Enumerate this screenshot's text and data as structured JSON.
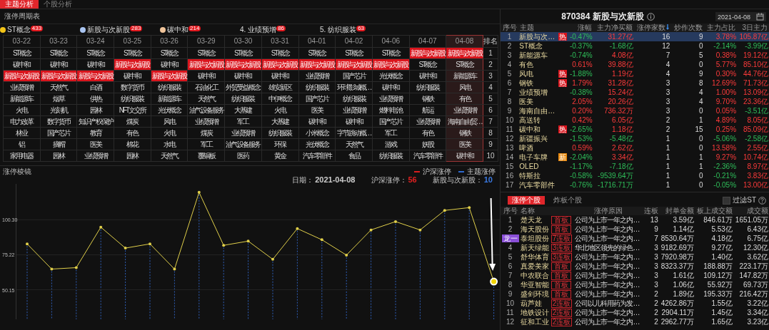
{
  "top_tabs": [
    {
      "label": "主题分析",
      "selected": true
    },
    {
      "label": "个股分析",
      "selected": false
    }
  ],
  "cycle_table": {
    "title": "涨停周期表",
    "leaders": [
      {
        "label": "ST概念",
        "count": "433",
        "kind": "medal",
        "color": "#f2c418"
      },
      {
        "label": "新股与次新股",
        "count": "283",
        "kind": "medal",
        "color": "#a9c4f0"
      },
      {
        "label": "碳中和",
        "count": "214",
        "kind": "medal",
        "color": "#f0c49a"
      },
      {
        "label": "4. 业绩预增",
        "count": "86",
        "kind": "plain"
      },
      {
        "label": "5. 纺织服装",
        "count": "63",
        "kind": "plain"
      }
    ],
    "rank_header": "排名",
    "ranks": [
      "1",
      "2",
      "3",
      "4",
      "5",
      "6",
      "7",
      "8",
      "9",
      "10"
    ],
    "columns": [
      {
        "date": "03-22",
        "selected": false,
        "cells": [
          {
            "text": "ST概念",
            "hot": false
          },
          {
            "text": "碳中和",
            "hot": false
          },
          {
            "text": "新股与次新股",
            "hot": true
          },
          {
            "text": "业绩预增",
            "hot": false
          },
          {
            "text": "新能源车",
            "hot": false
          },
          {
            "text": "火电",
            "hot": false
          },
          {
            "text": "电力改革",
            "hot": false
          },
          {
            "text": "林业",
            "hot": false
          },
          {
            "text": "铝",
            "hot": false
          },
          {
            "text": "家用电器",
            "hot": false
          }
        ]
      },
      {
        "date": "03-23",
        "selected": false,
        "cells": [
          {
            "text": "ST概念",
            "hot": false
          },
          {
            "text": "碳中和",
            "hot": false
          },
          {
            "text": "新股与次新股",
            "hot": true
          },
          {
            "text": "天然气",
            "hot": false
          },
          {
            "text": "烟草",
            "hot": false
          },
          {
            "text": "光刻机",
            "hot": false
          },
          {
            "text": "数字货币",
            "hot": false
          },
          {
            "text": "国产芯片",
            "hot": false
          },
          {
            "text": "摘帽",
            "hot": false
          },
          {
            "text": "园林",
            "hot": false
          }
        ]
      },
      {
        "date": "03-24",
        "selected": false,
        "cells": [
          {
            "text": "ST概念",
            "hot": false
          },
          {
            "text": "碳中和",
            "hot": false
          },
          {
            "text": "新股与次新股",
            "hot": true
          },
          {
            "text": "白酒",
            "hot": false
          },
          {
            "text": "供热",
            "hot": false
          },
          {
            "text": "园林",
            "hot": false
          },
          {
            "text": "知识产权保护",
            "hot": false
          },
          {
            "text": "教育",
            "hot": false
          },
          {
            "text": "医美",
            "hot": false
          },
          {
            "text": "业绩预增",
            "hot": false
          }
        ]
      },
      {
        "date": "03-25",
        "selected": false,
        "cells": [
          {
            "text": "ST概念",
            "hot": false
          },
          {
            "text": "新股与次新股",
            "hot": true
          },
          {
            "text": "碳中和",
            "hot": false
          },
          {
            "text": "数字货币",
            "hot": false
          },
          {
            "text": "纺织服装",
            "hot": false
          },
          {
            "text": "NFT文交所",
            "hot": false
          },
          {
            "text": "煤炭",
            "hot": false
          },
          {
            "text": "有色",
            "hot": false
          },
          {
            "text": "棉花",
            "hot": false
          },
          {
            "text": "园林",
            "hot": false
          }
        ]
      },
      {
        "date": "03-26",
        "selected": false,
        "cells": [
          {
            "text": "ST概念",
            "hot": false
          },
          {
            "text": "碳中和",
            "hot": false
          },
          {
            "text": "新股与次新股",
            "hot": true
          },
          {
            "text": "纺织服装",
            "hot": false
          },
          {
            "text": "新能源车",
            "hot": false
          },
          {
            "text": "光伏概念",
            "hot": false
          },
          {
            "text": "风电",
            "hot": false
          },
          {
            "text": "火电",
            "hot": false
          },
          {
            "text": "水电",
            "hot": false
          },
          {
            "text": "天然气",
            "hot": false
          }
        ]
      },
      {
        "date": "03-29",
        "selected": false,
        "cells": [
          {
            "text": "ST概念",
            "hot": false
          },
          {
            "text": "新股与次新股",
            "hot": true
          },
          {
            "text": "碳中和",
            "hot": false
          },
          {
            "text": "石油化工",
            "hot": false
          },
          {
            "text": "天然气",
            "hot": false
          },
          {
            "text": "油气设备服务",
            "hot": false
          },
          {
            "text": "业绩预增",
            "hot": false
          },
          {
            "text": "煤炭",
            "hot": false
          },
          {
            "text": "军工",
            "hot": false
          },
          {
            "text": "覆铜板",
            "hot": false
          }
        ]
      },
      {
        "date": "03-30",
        "selected": false,
        "cells": [
          {
            "text": "ST概念",
            "hot": false
          },
          {
            "text": "新股与次新股",
            "hot": true
          },
          {
            "text": "碳中和",
            "hot": false
          },
          {
            "text": "外贸受益概念",
            "hot": false
          },
          {
            "text": "纺织服装",
            "hot": false
          },
          {
            "text": "大基建",
            "hot": false
          },
          {
            "text": "军工",
            "hot": false
          },
          {
            "text": "业绩预增",
            "hot": false
          },
          {
            "text": "油气设备服务",
            "hot": false
          },
          {
            "text": "医药",
            "hot": false
          }
        ]
      },
      {
        "date": "03-31",
        "selected": false,
        "cells": [
          {
            "text": "ST概念",
            "hot": false
          },
          {
            "text": "新股与次新股",
            "hot": true
          },
          {
            "text": "碳中和",
            "hot": false
          },
          {
            "text": "雄安新区",
            "hot": false
          },
          {
            "text": "中伊概念",
            "hot": false
          },
          {
            "text": "火电",
            "hot": false
          },
          {
            "text": "大基建",
            "hot": false
          },
          {
            "text": "纺织服装",
            "hot": false
          },
          {
            "text": "环保",
            "hot": false
          },
          {
            "text": "黄金",
            "hot": false
          }
        ]
      },
      {
        "date": "04-01",
        "selected": false,
        "cells": [
          {
            "text": "ST概念",
            "hot": false
          },
          {
            "text": "新股与次新股",
            "hot": true
          },
          {
            "text": "业绩预增",
            "hot": false
          },
          {
            "text": "纺织服装",
            "hot": false
          },
          {
            "text": "国产芯片",
            "hot": false
          },
          {
            "text": "医美",
            "hot": false
          },
          {
            "text": "碳中和",
            "hot": false
          },
          {
            "text": "小米概念",
            "hot": false
          },
          {
            "text": "光伏概念",
            "hot": false
          },
          {
            "text": "汽车零部件",
            "hot": false
          }
        ]
      },
      {
        "date": "04-02",
        "selected": false,
        "cells": [
          {
            "text": "ST概念",
            "hot": false
          },
          {
            "text": "新股与次新股",
            "hot": true
          },
          {
            "text": "国产芯片",
            "hot": false
          },
          {
            "text": "环球影城概…",
            "hot": false
          },
          {
            "text": "纺织服装",
            "hot": false
          },
          {
            "text": "业绩预增",
            "hot": false
          },
          {
            "text": "碳中和",
            "hot": false
          },
          {
            "text": "字节跳动概…",
            "hot": false
          },
          {
            "text": "天然气",
            "hot": false
          },
          {
            "text": "食品",
            "hot": false
          }
        ]
      },
      {
        "date": "04-06",
        "selected": false,
        "cells": [
          {
            "text": "ST概念",
            "hot": false
          },
          {
            "text": "新股与次新股",
            "hot": true
          },
          {
            "text": "光伏概念",
            "hot": false
          },
          {
            "text": "碳中和",
            "hot": false
          },
          {
            "text": "业绩预增",
            "hot": false
          },
          {
            "text": "燃料电池",
            "hot": false
          },
          {
            "text": "国产芯片",
            "hot": false
          },
          {
            "text": "军工",
            "hot": false
          },
          {
            "text": "游戏",
            "hot": false
          },
          {
            "text": "纺织服装",
            "hot": false
          }
        ]
      },
      {
        "date": "04-07",
        "selected": false,
        "cells": [
          {
            "text": "新股与次新股",
            "hot": true
          },
          {
            "text": "ST概念",
            "hot": false
          },
          {
            "text": "碳中和",
            "hot": false
          },
          {
            "text": "纺织服装",
            "hot": false
          },
          {
            "text": "钢铁",
            "hot": false
          },
          {
            "text": "航运",
            "hot": false
          },
          {
            "text": "业绩预增",
            "hot": false
          },
          {
            "text": "有色",
            "hot": false
          },
          {
            "text": "妖股",
            "hot": false
          },
          {
            "text": "汽车零部件",
            "hot": false
          }
        ]
      },
      {
        "date": "04-08",
        "selected": true,
        "cells": [
          {
            "text": "新股与次新股",
            "hot": true
          },
          {
            "text": "ST概念",
            "hot": false
          },
          {
            "text": "新能源车",
            "hot": false
          },
          {
            "text": "风电",
            "hot": false
          },
          {
            "text": "有色",
            "hot": false
          },
          {
            "text": "业绩预增",
            "hot": false
          },
          {
            "text": "海南自由贸…",
            "hot": false
          },
          {
            "text": "钢铁",
            "hot": false
          },
          {
            "text": "医美",
            "hot": false
          },
          {
            "text": "碳中和",
            "hot": false
          }
        ]
      }
    ]
  },
  "prism": {
    "title": "涨停棱镜",
    "legend": [
      {
        "label": "沪深涨停",
        "color": "#d81e1e"
      },
      {
        "label": "主题涨停",
        "color": "#2f6ad0"
      }
    ],
    "info": [
      {
        "label": "日期：",
        "value": "2021-04-08",
        "color": "#cccccc"
      },
      {
        "label": "沪深涨停：",
        "value": "56",
        "color": "#e02020"
      },
      {
        "label": "新股与次新股：",
        "value": "10",
        "color": "#3a78e0"
      }
    ],
    "chart_data": {
      "type": "line",
      "grid": true,
      "ylim": [
        29,
        126
      ],
      "yticks": [
        {
          "value": 50.15,
          "label": "50.15"
        },
        {
          "value": 75.22,
          "label": "75.22"
        },
        {
          "value": 100.3,
          "label": "100.30"
        }
      ],
      "series": [
        {
          "color": "#e0cf4a",
          "values": [
            83,
            65,
            66,
            95,
            80,
            83,
            65,
            120,
            82,
            85,
            72,
            94,
            86,
            75,
            93,
            99,
            93,
            107,
            109,
            56
          ]
        }
      ]
    }
  },
  "theme_panel": {
    "code": "870384",
    "name": "新股与次新股",
    "date": "2021-04-08",
    "columns": [
      {
        "label": "序号",
        "sorted": false
      },
      {
        "label": "主题",
        "sorted": false
      },
      {
        "label": "涨幅",
        "sorted": false
      },
      {
        "label": "主力净买额",
        "sorted": false
      },
      {
        "label": "涨停家数",
        "sorted": true
      },
      {
        "label": "炒作次数",
        "sorted": false
      },
      {
        "label": "主力占比",
        "sorted": false
      },
      {
        "label": "3日主力",
        "sorted": false
      }
    ],
    "rows": [
      {
        "no": "1",
        "name": "新股与次…",
        "tag": {
          "text": "热",
          "kind": "hot"
        },
        "selected": true,
        "change": {
          "v": "-0.47%",
          "up": false
        },
        "net": {
          "v": "31.27亿",
          "up": true
        },
        "limit_count": "16",
        "hype_count": "9",
        "ratio": {
          "v": "3.78%",
          "up": true
        },
        "net3": {
          "v": "105.87亿",
          "up": true
        }
      },
      {
        "no": "2",
        "name": "ST概念",
        "selected": false,
        "change": {
          "v": "-0.37%",
          "up": false
        },
        "net": {
          "v": "-1.68亿",
          "up": false
        },
        "limit_count": "12",
        "hype_count": "0",
        "ratio": {
          "v": "-2.14%",
          "up": false
        },
        "net3": {
          "v": "-3.99亿",
          "up": false
        }
      },
      {
        "no": "3",
        "name": "新能源车",
        "selected": false,
        "change": {
          "v": "-0.74%",
          "up": false
        },
        "net": {
          "v": "4.08亿",
          "up": true
        },
        "limit_count": "7",
        "hype_count": "5",
        "ratio": {
          "v": "0.38%",
          "up": true
        },
        "net3": {
          "v": "19.12亿",
          "up": true
        }
      },
      {
        "no": "4",
        "name": "有色",
        "selected": false,
        "change": {
          "v": "0.61%",
          "up": true
        },
        "net": {
          "v": "39.88亿",
          "up": true
        },
        "limit_count": "4",
        "hype_count": "0",
        "ratio": {
          "v": "5.77%",
          "up": true
        },
        "net3": {
          "v": "85.10亿",
          "up": true
        }
      },
      {
        "no": "5",
        "name": "风电",
        "tag": {
          "text": "热",
          "kind": "hot"
        },
        "selected": false,
        "change": {
          "v": "-1.88%",
          "up": false
        },
        "net": {
          "v": "1.19亿",
          "up": true
        },
        "limit_count": "4",
        "hype_count": "9",
        "ratio": {
          "v": "0.30%",
          "up": true
        },
        "net3": {
          "v": "44.76亿",
          "up": true
        }
      },
      {
        "no": "6",
        "name": "钢铁",
        "tag": {
          "text": "热",
          "kind": "hot"
        },
        "selected": false,
        "change": {
          "v": "1.79%",
          "up": true
        },
        "net": {
          "v": "31.28亿",
          "up": true
        },
        "limit_count": "3",
        "hype_count": "8",
        "ratio": {
          "v": "12.69%",
          "up": true
        },
        "net3": {
          "v": "71.73亿",
          "up": true
        }
      },
      {
        "no": "7",
        "name": "业绩预增",
        "selected": false,
        "change": {
          "v": "-0.38%",
          "up": false
        },
        "net": {
          "v": "15.24亿",
          "up": true
        },
        "limit_count": "3",
        "hype_count": "4",
        "ratio": {
          "v": "1.00%",
          "up": true
        },
        "net3": {
          "v": "13.09亿",
          "up": true
        }
      },
      {
        "no": "8",
        "name": "医美",
        "selected": false,
        "change": {
          "v": "2.05%",
          "up": true
        },
        "net": {
          "v": "20.26亿",
          "up": true
        },
        "limit_count": "3",
        "hype_count": "4",
        "ratio": {
          "v": "9.70%",
          "up": true
        },
        "net3": {
          "v": "23.36亿",
          "up": true
        }
      },
      {
        "no": "9",
        "name": "海南自由…",
        "selected": false,
        "change": {
          "v": "0.20%",
          "up": true
        },
        "net": {
          "v": "736.32万",
          "up": true
        },
        "limit_count": "3",
        "hype_count": "0",
        "ratio": {
          "v": "0.05%",
          "up": true
        },
        "net3": {
          "v": "-3.51亿",
          "up": false
        }
      },
      {
        "no": "10",
        "name": "高送转",
        "selected": false,
        "change": {
          "v": "0.42%",
          "up": true
        },
        "net": {
          "v": "6.05亿",
          "up": true
        },
        "limit_count": "2",
        "hype_count": "1",
        "ratio": {
          "v": "4.89%",
          "up": true
        },
        "net3": {
          "v": "8.05亿",
          "up": true
        }
      },
      {
        "no": "11",
        "name": "碳中和",
        "tag": {
          "text": "热",
          "kind": "hot"
        },
        "selected": false,
        "change": {
          "v": "-2.65%",
          "up": false
        },
        "net": {
          "v": "1.18亿",
          "up": true
        },
        "limit_count": "2",
        "hype_count": "15",
        "ratio": {
          "v": "0.25%",
          "up": true
        },
        "net3": {
          "v": "85.09亿",
          "up": true
        }
      },
      {
        "no": "12",
        "name": "新疆振兴",
        "selected": false,
        "change": {
          "v": "-1.53%",
          "up": false
        },
        "net": {
          "v": "-5.48亿",
          "up": false
        },
        "limit_count": "1",
        "hype_count": "0",
        "ratio": {
          "v": "-5.06%",
          "up": false
        },
        "net3": {
          "v": "-2.58亿",
          "up": false
        }
      },
      {
        "no": "13",
        "name": "啤酒",
        "selected": false,
        "change": {
          "v": "0.59%",
          "up": true
        },
        "net": {
          "v": "2.62亿",
          "up": true
        },
        "limit_count": "1",
        "hype_count": "0",
        "ratio": {
          "v": "13.58%",
          "up": true
        },
        "net3": {
          "v": "2.55亿",
          "up": true
        }
      },
      {
        "no": "14",
        "name": "电子车牌",
        "tag": {
          "text": "新",
          "kind": "new"
        },
        "selected": false,
        "change": {
          "v": "-2.04%",
          "up": false
        },
        "net": {
          "v": "3.34亿",
          "up": true
        },
        "limit_count": "1",
        "hype_count": "1",
        "ratio": {
          "v": "9.27%",
          "up": true
        },
        "net3": {
          "v": "10.74亿",
          "up": true
        }
      },
      {
        "no": "15",
        "name": "OLED",
        "selected": false,
        "change": {
          "v": "-1.17%",
          "up": false
        },
        "net": {
          "v": "-7.18亿",
          "up": false
        },
        "limit_count": "1",
        "hype_count": "1",
        "ratio": {
          "v": "-2.36%",
          "up": false
        },
        "net3": {
          "v": "8.97亿",
          "up": true
        }
      },
      {
        "no": "16",
        "name": "特斯拉",
        "selected": false,
        "change": {
          "v": "-0.58%",
          "up": false
        },
        "net": {
          "v": "-9539.64万",
          "up": false
        },
        "limit_count": "1",
        "hype_count": "0",
        "ratio": {
          "v": "-0.21%",
          "up": false
        },
        "net3": {
          "v": "3.83亿",
          "up": true
        }
      },
      {
        "no": "17",
        "name": "汽车零部件",
        "selected": false,
        "change": {
          "v": "-0.76%",
          "up": false
        },
        "net": {
          "v": "-1716.71万",
          "up": false
        },
        "limit_count": "1",
        "hype_count": "0",
        "ratio": {
          "v": "-0.05%",
          "up": false
        },
        "net3": {
          "v": "13.00亿",
          "up": true
        }
      }
    ]
  },
  "stocks_panel": {
    "tabs": [
      {
        "label": "涨停个股",
        "selected": true
      },
      {
        "label": "炸板个股",
        "selected": false
      }
    ],
    "filter": {
      "label": "过滤ST",
      "checked": false
    },
    "columns": [
      "序号",
      "名称",
      "涨停原因",
      "连板",
      "封单金额",
      "板上成交额",
      "成交额"
    ],
    "rows": [
      {
        "no": {
          "text": "1",
          "kind": "plain"
        },
        "name": "楚天龙",
        "board": "首板",
        "reason": "公司为上市一年之内…",
        "streak": "13",
        "seal": "3.59亿",
        "on_board": "846.61万",
        "turnover": "1651.05万"
      },
      {
        "no": {
          "text": "2",
          "kind": "plain"
        },
        "name": "海天股份",
        "board": "首板",
        "reason": "公司为上市一年之内…",
        "streak": "9",
        "seal": "1.14亿",
        "on_board": "5.53亿",
        "turnover": "6.43亿"
      },
      {
        "no": {
          "text": "龙一",
          "kind": "badge"
        },
        "name": "泰坦股份",
        "board": "7连板",
        "reason": "公司为上市一年之内…",
        "streak": "7",
        "seal": "8530.64万",
        "on_board": "4.18亿",
        "turnover": "6.75亿"
      },
      {
        "no": {
          "text": "4",
          "kind": "plain"
        },
        "name": "新天绿能",
        "board": "3连板",
        "reason": "华北地区领先的绿色…",
        "streak": "3",
        "seal": "9182.69万",
        "on_board": "9.27亿",
        "turnover": "12.30亿"
      },
      {
        "no": {
          "text": "5",
          "kind": "plain"
        },
        "name": "舒华体育",
        "board": "3连板",
        "reason": "公司为上市一年之内…",
        "streak": "3",
        "seal": "7920.98万",
        "on_board": "1.40亿",
        "turnover": "3.62亿"
      },
      {
        "no": {
          "text": "6",
          "kind": "plain"
        },
        "name": "真爱美家",
        "board": "首板",
        "reason": "公司为上市一年之内…",
        "streak": "3",
        "seal": "8323.37万",
        "on_board": "188.88万",
        "turnover": "223.17万"
      },
      {
        "no": {
          "text": "7",
          "kind": "plain"
        },
        "name": "中农联合",
        "board": "首板",
        "reason": "公司为上市一年之内…",
        "streak": "3",
        "seal": "1.61亿",
        "on_board": "109.12万",
        "turnover": "147.82万"
      },
      {
        "no": {
          "text": "8",
          "kind": "plain"
        },
        "name": "华亚智能",
        "board": "首板",
        "reason": "公司为上市一年之内…",
        "streak": "3",
        "seal": "1.06亿",
        "on_board": "55.92万",
        "turnover": "69.73万"
      },
      {
        "no": {
          "text": "9",
          "kind": "plain"
        },
        "name": "盛剑环境",
        "board": "首板",
        "reason": "公司为上市一年之内…",
        "streak": "2",
        "seal": "1.89亿",
        "on_board": "195.33万",
        "turnover": "216.42万"
      },
      {
        "no": {
          "text": "10",
          "kind": "plain"
        },
        "name": "葫芦娃",
        "board": "2连板",
        "reason": "公司以儿科用药为发…",
        "streak": "2",
        "seal": "4262.86万",
        "on_board": "1.55亿",
        "turnover": "3.22亿"
      },
      {
        "no": {
          "text": "11",
          "kind": "plain"
        },
        "name": "地铁设计",
        "board": "2连板",
        "reason": "公司为上市一年之内…",
        "streak": "2",
        "seal": "2904.11万",
        "on_board": "1.45亿",
        "turnover": "3.34亿"
      },
      {
        "no": {
          "text": "12",
          "kind": "plain"
        },
        "name": "征和工业",
        "board": "2连板",
        "reason": "公司为上市一年之内…",
        "streak": "2",
        "seal": "2962.77万",
        "on_board": "1.65亿",
        "turnover": "3.23亿"
      }
    ]
  }
}
